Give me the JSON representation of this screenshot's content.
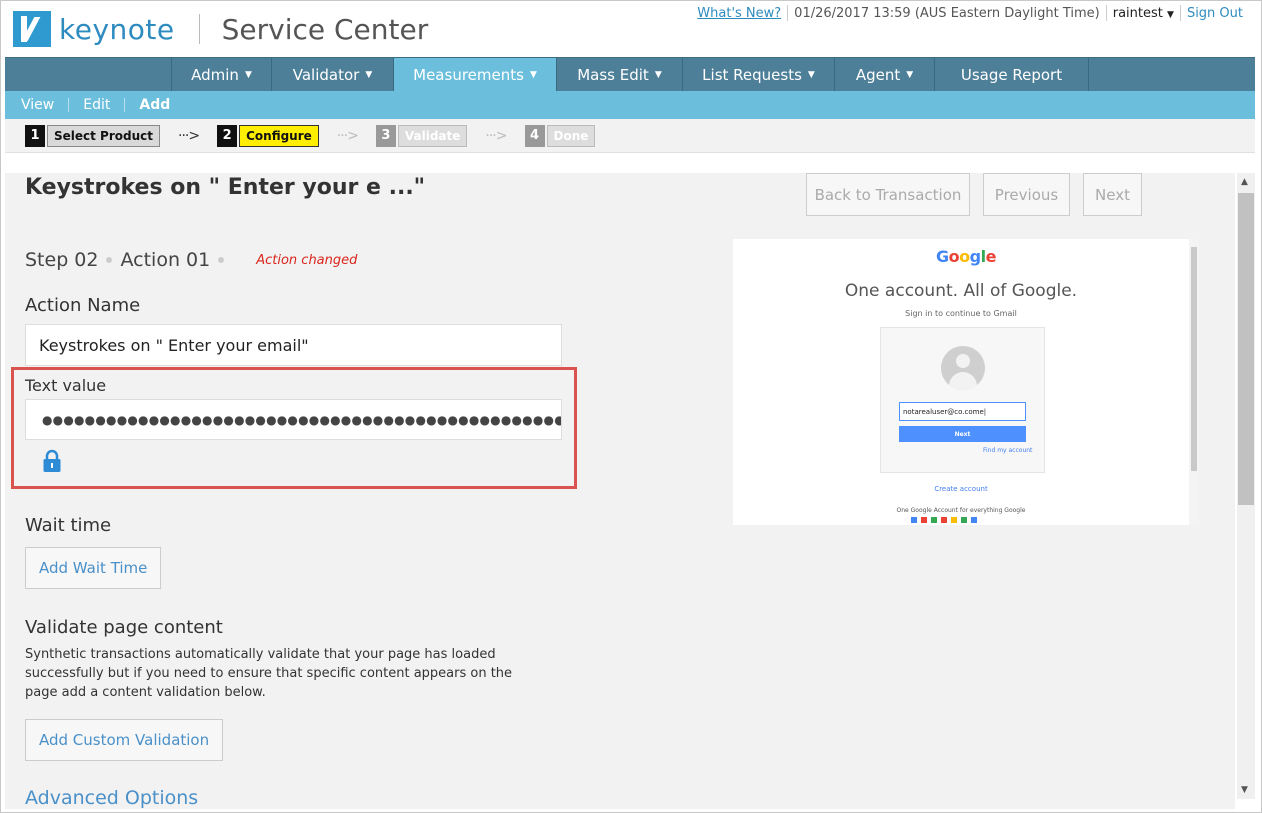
{
  "header": {
    "logo_text": "keynote",
    "app_title": "Service Center",
    "whats_new": "What's New?",
    "datetime": "01/26/2017 13:59 (AUS Eastern Daylight Time)",
    "user": "raintest",
    "sign_out": "Sign Out"
  },
  "nav": {
    "items": [
      {
        "label": "Admin"
      },
      {
        "label": "Validator"
      },
      {
        "label": "Measurements"
      },
      {
        "label": "Mass Edit"
      },
      {
        "label": "List Requests"
      },
      {
        "label": "Agent"
      },
      {
        "label": "Usage Report"
      }
    ],
    "active": "Measurements"
  },
  "subnav": {
    "items": [
      {
        "label": "View"
      },
      {
        "label": "Edit"
      },
      {
        "label": "Add"
      }
    ],
    "active": "Add"
  },
  "wizard": {
    "steps": [
      {
        "num": "1",
        "label": "Select Product"
      },
      {
        "num": "2",
        "label": "Configure"
      },
      {
        "num": "3",
        "label": "Validate"
      },
      {
        "num": "4",
        "label": "Done"
      }
    ],
    "arrow": "···>"
  },
  "main": {
    "title": "Keystrokes on \" Enter your e ...\"",
    "back_button": "Back to Transaction",
    "previous_button": "Previous",
    "next_button": "Next",
    "step_label": "Step 02",
    "action_label": "Action 01",
    "action_changed": "Action changed",
    "action_name_label": "Action Name",
    "action_name_value": "Keystrokes on \"  Enter your email\"",
    "text_value_label": "Text value",
    "text_value_masked": "●●●●●●●●●●●●●●●●●●●●●●●●●●●●●●●●●●●●●●●●●●●●●●●●●●●●●●●●●●●●●●●●●●●●●●●",
    "wait_time_label": "Wait time",
    "add_wait_time": "Add Wait Time",
    "validate_label": "Validate page content",
    "validate_desc": "Synthetic transactions automatically validate that your page has loaded successfully but if you need to ensure that specific content appears on the page add a content validation below.",
    "add_custom_validation": "Add Custom Validation",
    "advanced_options": "Advanced Options"
  },
  "thumbnail": {
    "logo": [
      "G",
      "o",
      "o",
      "g",
      "l",
      "e"
    ],
    "headline": "One account. All of Google.",
    "subline": "Sign in to continue to Gmail",
    "email": "notarealuser@co.come|",
    "next_btn": "Next",
    "find_account": "Find my account",
    "create_account": "Create account",
    "footer": "One Google Account for everything Google"
  },
  "colors": {
    "nav_bg": "#4e7f98",
    "nav_active": "#6cbfdc",
    "highlight": "#d9534f",
    "configure_yellow": "#ffee00"
  }
}
